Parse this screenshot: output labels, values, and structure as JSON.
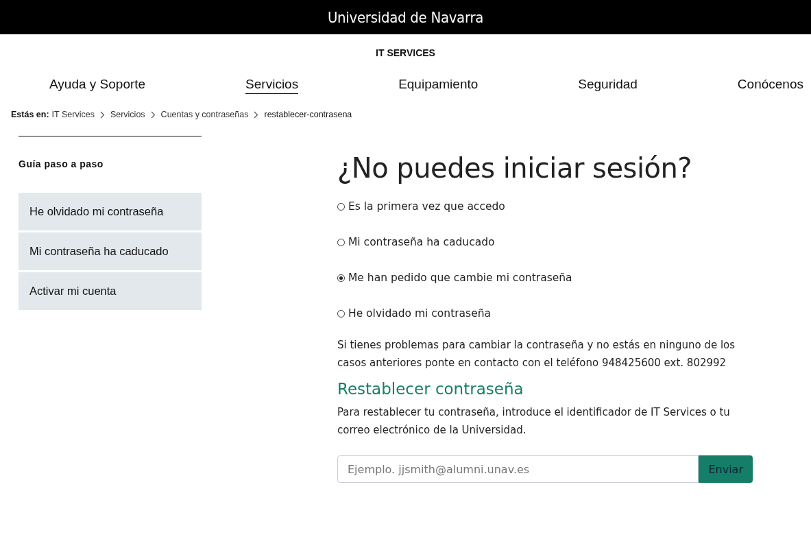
{
  "top_bar": {
    "title": "Universidad de Navarra"
  },
  "site_title": "IT SERVICES",
  "nav": [
    {
      "label": "Ayuda y Soporte",
      "selected": false
    },
    {
      "label": "Servicios",
      "selected": true
    },
    {
      "label": "Equipamiento",
      "selected": false
    },
    {
      "label": "Seguridad",
      "selected": false
    },
    {
      "label": "Conócenos",
      "selected": false
    }
  ],
  "breadcrumb": {
    "label": "Estás en:",
    "items": [
      "IT Services",
      "Servicios",
      "Cuentas y contraseñas",
      "restablecer-contrasena"
    ]
  },
  "sidebar": {
    "title": "Guía paso a paso",
    "items": [
      "He olvidado mi contraseña",
      "Mi contraseña ha caducado",
      "Activar mi cuenta"
    ]
  },
  "main": {
    "heading": "¿No puedes iniciar sesión?",
    "options": [
      {
        "label": "Es la primera vez que accedo",
        "selected": false
      },
      {
        "label": "Mi contraseña ha caducado",
        "selected": false
      },
      {
        "label": "Me han pedido que cambie mi contraseña",
        "selected": true
      },
      {
        "label": "He olvidado mi contraseña",
        "selected": false
      }
    ],
    "help_text": "Si tienes problemas para cambiar la contraseña y no estás en ninguno de los casos anteriores ponte en contacto con el teléfono 948425600 ext. 802992",
    "section_title": "Restablecer contraseña",
    "instructions": "Para restablecer tu contraseña, introduce el identificador de IT Services o tu correo electrónico de la Universidad.",
    "email_field": {
      "placeholder": "Ejemplo. jjsmith@alumni.unav.es"
    },
    "submit_button": "Enviar"
  }
}
